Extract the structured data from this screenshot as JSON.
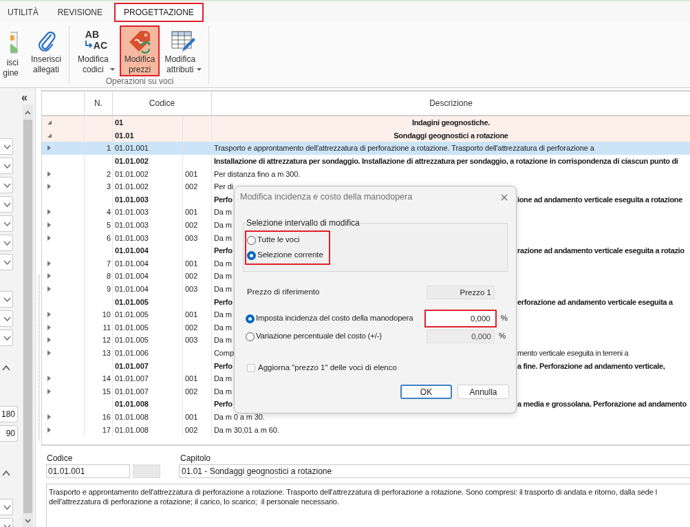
{
  "tabs": [
    {
      "label": "UTILITÀ",
      "selected": false
    },
    {
      "label": "REVISIONE",
      "selected": false
    },
    {
      "label": "PROGETTAZIONE",
      "selected": true
    }
  ],
  "ribbon": {
    "groups": [
      {
        "buttons": [
          {
            "kind": "image",
            "label": "isci\ngine",
            "dropdown": false,
            "selected": false
          },
          {
            "kind": "attach",
            "label": "Inserisci\nallegati",
            "dropdown": false,
            "selected": false
          }
        ]
      },
      {
        "label": "Operazioni su voci",
        "buttons": [
          {
            "kind": "codes",
            "icon_letters": [
              "AB",
              "AC"
            ],
            "label": "Modifica\ncodici",
            "dropdown": true,
            "selected": false
          },
          {
            "kind": "prices",
            "label": "Modifica\nprezzi",
            "dropdown": false,
            "selected": true
          },
          {
            "kind": "attributes",
            "label": "Modifica\nattributi",
            "dropdown": true,
            "selected": false
          }
        ]
      }
    ]
  },
  "left_panel": {
    "collapse_glyph": "«",
    "values": [
      "180",
      "90"
    ]
  },
  "table": {
    "columns": [
      "N.",
      "Codice",
      "Descrizione"
    ],
    "rows": [
      {
        "kind": "group",
        "code": "01",
        "desc": "Indagini geognostiche.",
        "selected": false
      },
      {
        "kind": "group",
        "code": "01.01",
        "desc": "Sondaggi geognostici a rotazione",
        "selected": false
      },
      {
        "kind": "item",
        "n": "1",
        "code": "01.01.001",
        "desc": "Trasporto e approntamento dell'attrezzatura di perforazione a rotazione. Trasporto dell'attrezzatura di perforazione a",
        "selected": true
      },
      {
        "kind": "heading",
        "code": "01.01.002",
        "desc": "Installazione di attrezzatura per sondaggio. Installazione di attrezzatura per sondaggio, a rotazione in corrispondenza di ciascun punto di",
        "selected": false
      },
      {
        "kind": "item",
        "n": "2",
        "code": "01.01.002",
        "sub": "001",
        "desc": "Per distanza fino a m 300.",
        "selected": false
      },
      {
        "kind": "item",
        "n": "3",
        "code": "01.01.002",
        "sub": "002",
        "desc": "Per di",
        "selected": false
      },
      {
        "kind": "heading",
        "code": "01.01.003",
        "desc": "Perfo",
        "desc_right": "ione ad andamento verticale eseguita a rotazione",
        "selected": false
      },
      {
        "kind": "item",
        "n": "4",
        "code": "01.01.003",
        "sub": "001",
        "desc": "Da m",
        "selected": false
      },
      {
        "kind": "item",
        "n": "5",
        "code": "01.01.003",
        "sub": "002",
        "desc": "Da m",
        "selected": false
      },
      {
        "kind": "item",
        "n": "6",
        "code": "01.01.003",
        "sub": "003",
        "desc": "Da m",
        "selected": false
      },
      {
        "kind": "heading",
        "code": "01.01.004",
        "desc": "Perfo",
        "desc_right": "razione ad andamento verticale eseguita a rotazio",
        "selected": false
      },
      {
        "kind": "item",
        "n": "7",
        "code": "01.01.004",
        "sub": "001",
        "desc": "Da m",
        "selected": false
      },
      {
        "kind": "item",
        "n": "8",
        "code": "01.01.004",
        "sub": "002",
        "desc": "Da m",
        "selected": false
      },
      {
        "kind": "item",
        "n": "9",
        "code": "01.01.004",
        "sub": "003",
        "desc": "Da m",
        "selected": false
      },
      {
        "kind": "heading",
        "code": "01.01.005",
        "desc": "Perfo",
        "desc_right": "erforazione ad andamento verticale eseguita a",
        "selected": false
      },
      {
        "kind": "item",
        "n": "10",
        "code": "01.01.005",
        "sub": "001",
        "desc": "Da m",
        "selected": false
      },
      {
        "kind": "item",
        "n": "11",
        "code": "01.01.005",
        "sub": "002",
        "desc": "Da m",
        "selected": false
      },
      {
        "kind": "item",
        "n": "12",
        "code": "01.01.005",
        "sub": "003",
        "desc": "Da m",
        "selected": false
      },
      {
        "kind": "item",
        "n": "13",
        "code": "01.01.006",
        "desc": "Comp",
        "desc_right": "mento verticale eseguita in terreni a",
        "selected": false
      },
      {
        "kind": "heading",
        "code": "01.01.007",
        "desc": "Perfo",
        "desc_right": "a fine. Perforazione ad andamento verticale,",
        "selected": false
      },
      {
        "kind": "item",
        "n": "14",
        "code": "01.01.007",
        "sub": "001",
        "desc": "Da m",
        "selected": false
      },
      {
        "kind": "item",
        "n": "15",
        "code": "01.01.007",
        "sub": "002",
        "desc": "Da m",
        "selected": false
      },
      {
        "kind": "heading",
        "code": "01.01.008",
        "desc": "Perfo",
        "desc_right": "a media e grossolana. Perforazione ad andamento",
        "selected": false
      },
      {
        "kind": "item",
        "n": "16",
        "code": "01.01.008",
        "sub": "001",
        "desc": "Da m 0 a m 30.",
        "selected": false
      },
      {
        "kind": "item",
        "n": "17",
        "code": "01.01.008",
        "sub": "002",
        "desc": "Da m 30,01 a m 60.",
        "selected": false
      }
    ]
  },
  "dialog": {
    "title": "Modifica incidenza e costo della manodopera",
    "range": {
      "legend": "Selezione intervallo di modifica",
      "options": [
        {
          "label": "Tutte le voci",
          "selected": false
        },
        {
          "label": "Selezione corrente",
          "selected": true
        }
      ]
    },
    "reference": {
      "label": "Prezzo di riferimento",
      "value": "Prezzo 1"
    },
    "modes": [
      {
        "label": "Imposta incidenza del costo della manodopera",
        "value": "0,000",
        "unit": "%",
        "selected": true
      },
      {
        "label": "Variazione percentuale del costo (+/-)",
        "value": "0,000",
        "unit": "%",
        "selected": false
      }
    ],
    "update_checkbox": {
      "label": "Aggiorna \"prezzo 1\" delle voci di elenco",
      "checked": false
    },
    "buttons": [
      "OK",
      "Annulla"
    ]
  },
  "detail": {
    "code_label": "Codice",
    "code_value": "01.01.001",
    "chapter_label": "Capitolo",
    "chapter_value": "01.01 - Sondaggi geognostici a rotazione",
    "description": "Trasporto e approntamento dell'attrezzatura di perforazione a rotazione. Trasporto dell'attrezzatura di perforazione a rotazione. Sono compresi: il trasporto di andata e ritorno, dalla sede l\ndell'attrezzatura di perforazione a rotazione; il carico, lo scarico;  il personale necessario."
  }
}
